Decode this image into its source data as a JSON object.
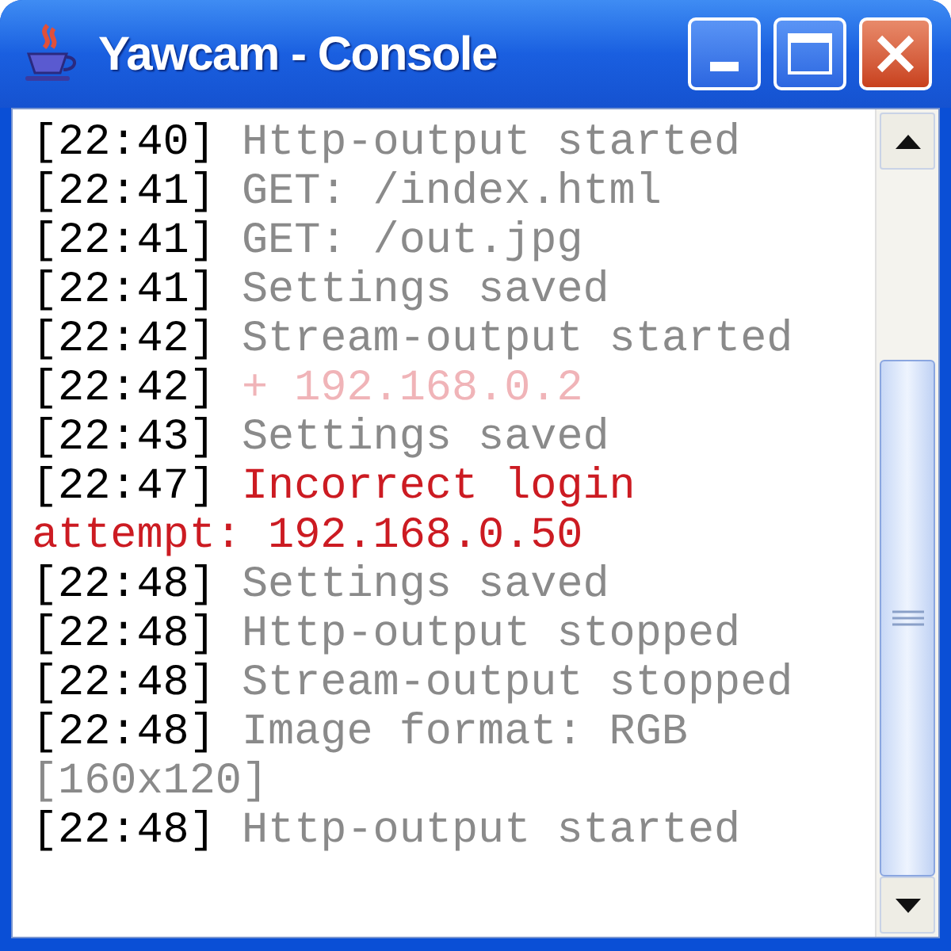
{
  "window": {
    "title": "Yawcam - Console"
  },
  "log": [
    {
      "time": "[22:40]",
      "message": "Http-output started",
      "kind": "info"
    },
    {
      "time": "[22:41]",
      "message": "GET: /index.html",
      "kind": "info"
    },
    {
      "time": "[22:41]",
      "message": "GET: /out.jpg",
      "kind": "info"
    },
    {
      "time": "[22:41]",
      "message": "Settings saved",
      "kind": "info"
    },
    {
      "time": "[22:42]",
      "message": "Stream-output started",
      "kind": "info"
    },
    {
      "time": "[22:42]",
      "message": "+ 192.168.0.2",
      "kind": "client"
    },
    {
      "time": "[22:43]",
      "message": "Settings saved",
      "kind": "info"
    },
    {
      "time": "[22:47]",
      "message": "Incorrect login",
      "continuation": "attempt: 192.168.0.50",
      "kind": "error"
    },
    {
      "time": "[22:48]",
      "message": "Settings saved",
      "kind": "info"
    },
    {
      "time": "[22:48]",
      "message": "Http-output stopped",
      "kind": "info"
    },
    {
      "time": "[22:48]",
      "message": "Stream-output stopped",
      "kind": "info"
    },
    {
      "time": "[22:48]",
      "message": "Image format: RGB",
      "continuation": "[160x120]",
      "kind": "info"
    },
    {
      "time": "[22:48]",
      "message": "Http-output started",
      "kind": "info"
    }
  ]
}
